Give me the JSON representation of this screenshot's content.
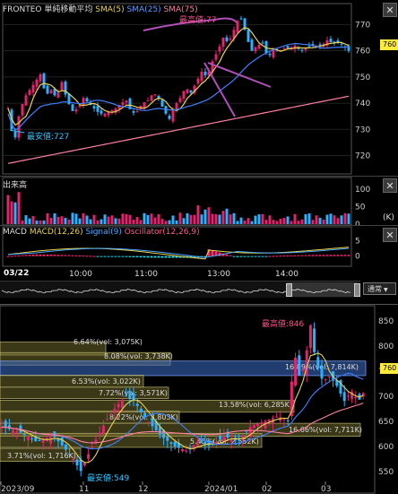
{
  "colors": {
    "up": "#e0256a",
    "down": "#2fb0ff",
    "sma5": "#e8d44d",
    "sma25": "#3f7fff",
    "sma75": "#ff7fa0",
    "annot": "#b050b8",
    "macd": "#e8d44d",
    "signal": "#4aa8ff",
    "osc_up": "#ff2f6f",
    "osc_down": "#2fd0e0",
    "price_tag": "#ffeb3b"
  },
  "intraday": {
    "legend": {
      "name": "FRONTEO",
      "indicator": "単純移動平均",
      "sma5": "SMA(5)",
      "sma25": "SMA(25)",
      "sma75": "SMA(75)"
    },
    "close_button": "✕",
    "y_ticks": [
      "770",
      "760",
      "750",
      "740",
      "730",
      "720"
    ],
    "price_tag": "760",
    "high_label": "最高値:77",
    "low_label": "最安値:727",
    "volume": {
      "title": "出来高",
      "ticks": [
        "100",
        "50",
        "0"
      ],
      "unit": "(K)"
    },
    "macd": {
      "title": "MACD",
      "macd_label": "MACD(12,26)",
      "signal_label": "Signal(9)",
      "osc_label": "Oscillator(12,26,9)",
      "ticks": [
        "5",
        "0"
      ]
    },
    "x_axis": {
      "date": "03/22",
      "ticks": [
        "10:00",
        "11:00",
        "13:00",
        "14:00"
      ]
    },
    "mode_select": "通常"
  },
  "daily": {
    "y_ticks": [
      "850",
      "800",
      "750",
      "700",
      "650",
      "600",
      "550"
    ],
    "price_tag": "760",
    "high_label": "最高値:846",
    "low_label": "最安値:549",
    "x_ticks": [
      "2023/09",
      "11",
      "12",
      "2024/01",
      "02",
      "03"
    ],
    "volume_profile": [
      "6.64%(vol: 3,075K)",
      "8.08%(vol: 3,738K)",
      "16.89%(vol: 7,814K)",
      "6.53%(vol: 3,022K)",
      "7.72%(vol: 3,571K)",
      "13.58%(vol: 6,285K)",
      "8.22%(vol: 3,803K)",
      "16.66%(vol: 7,711K)",
      "5.45%(vol: 2,552K)",
      "3.71%(vol: 1,716K)"
    ]
  }
}
